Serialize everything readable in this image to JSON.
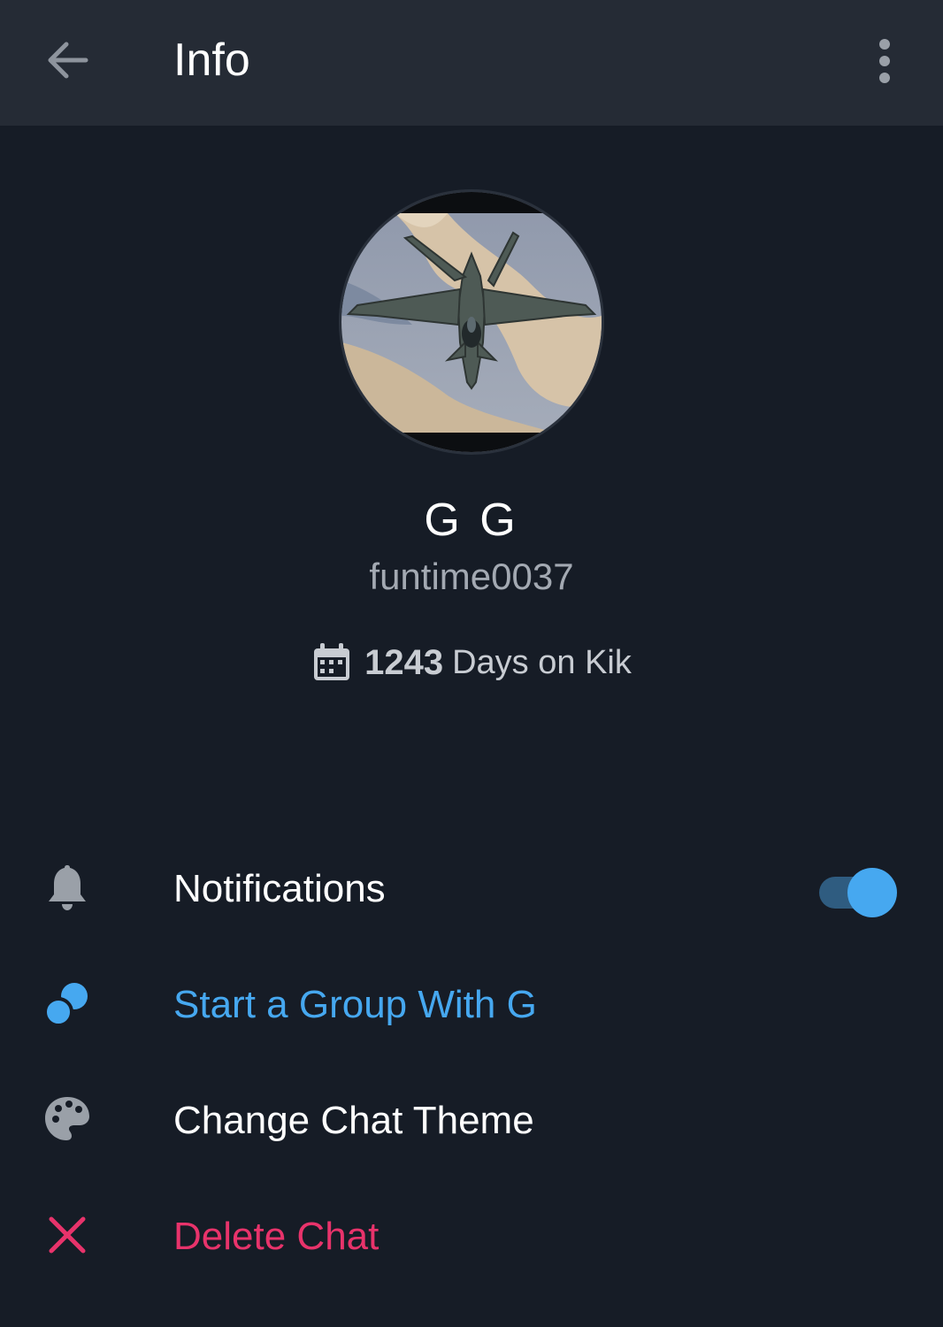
{
  "header": {
    "back_icon": "arrow-left-icon",
    "title": "Info",
    "menu_icon": "more-vertical-icon"
  },
  "profile": {
    "avatar_description": "fighter-jet-photo",
    "display_name": "G G",
    "username": "funtime0037",
    "calendar_icon": "calendar-icon",
    "days_count": "1243",
    "days_label": "Days on Kik"
  },
  "options": [
    {
      "icon": "bell-icon",
      "label": "Notifications",
      "color": "#ffffff",
      "toggle_on": true
    },
    {
      "icon": "group-icon",
      "label": "Start a Group With G",
      "color": "#46a8f0"
    },
    {
      "icon": "palette-icon",
      "label": "Change Chat Theme",
      "color": "#ffffff"
    },
    {
      "icon": "close-icon",
      "label": "Delete Chat",
      "color": "#e8336b"
    }
  ],
  "colors": {
    "background": "#161c26",
    "topbar": "#252b35",
    "accent": "#46a8f0",
    "danger": "#e8336b"
  }
}
